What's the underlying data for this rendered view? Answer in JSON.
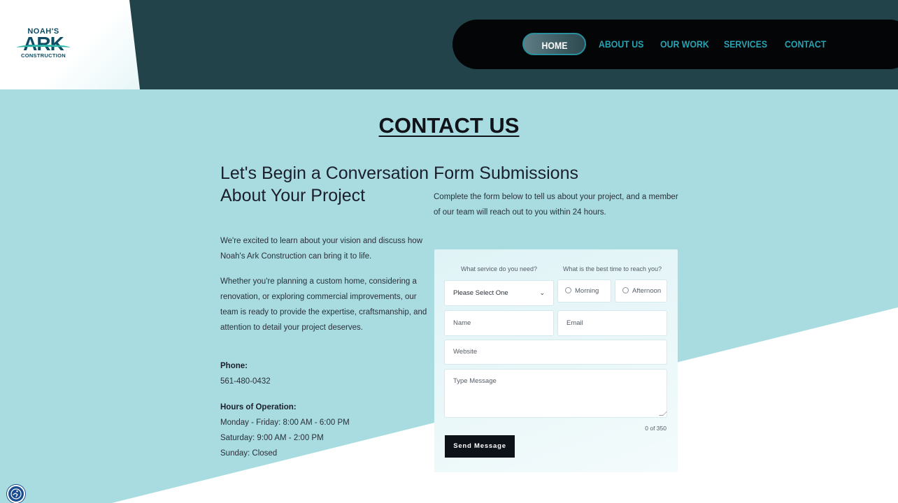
{
  "header": {
    "logo": {
      "top": "NOAH'S",
      "main": "ARK",
      "bottom": "CONSTRUCTION"
    },
    "nav": [
      {
        "label": "HOME",
        "active": true
      },
      {
        "label": "ABOUT US",
        "active": false
      },
      {
        "label": "OUR WORK",
        "active": false
      },
      {
        "label": "SERVICES",
        "active": false
      },
      {
        "label": "CONTACT",
        "active": false
      }
    ]
  },
  "page": {
    "title": "CONTACT US"
  },
  "left": {
    "heading": "Let's Begin a Conversation About Your Project",
    "paragraph1": "We're excited to learn about your vision and discuss how Noah's Ark Construction can bring it to life.",
    "paragraph2": "Whether you're planning a custom home, considering a renovation, or exploring commercial improvements, our team is ready to provide the expertise, craftsmanship, and attention to detail your project deserves.",
    "phone_label": "Phone:",
    "phone": "561-480-0432",
    "hours_label": "Hours of Operation:",
    "hours": [
      "Monday - Friday: 8:00 AM - 6:00 PM",
      "Saturday: 9:00 AM - 2:00 PM",
      "Sunday: Closed"
    ]
  },
  "right": {
    "heading": "Form Submissions",
    "intro": "Complete the form below to tell us about your project, and a member of our team will reach out to you within 24 hours."
  },
  "form": {
    "service_question": "What service do you need?",
    "time_question": "What is the best time to reach you?",
    "service_select_value": "Please Select One",
    "time_options": [
      "Morning",
      "Afternoon"
    ],
    "name_placeholder": "Name",
    "email_placeholder": "Email",
    "website_placeholder": "Website",
    "message_placeholder": "Type Message",
    "counter": "0 of 350",
    "submit_label": "Send Message"
  },
  "colors": {
    "header_bg": "#23434a",
    "nav_pill": "#040506",
    "nav_link": "#27a3b3",
    "page_bg": "#a8dce1",
    "button": "#0c1218"
  },
  "icons": {
    "accessibility": "accessibility-icon",
    "chevron": "chevron-down-icon"
  }
}
